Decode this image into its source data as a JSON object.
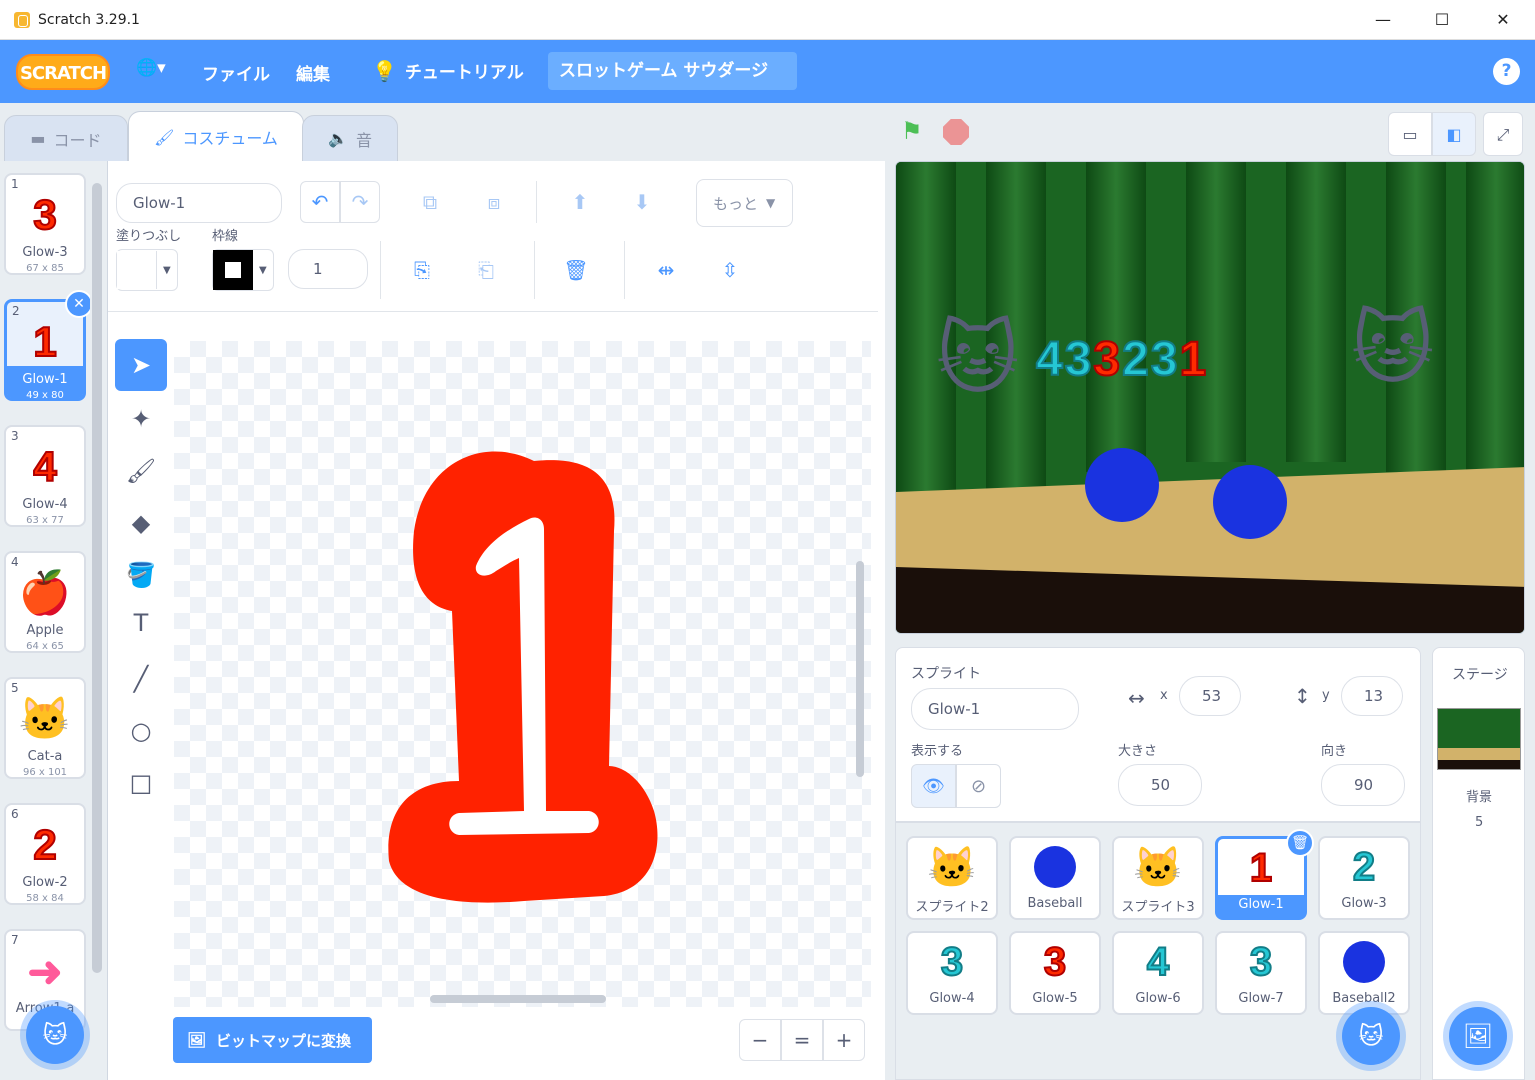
{
  "window": {
    "title": "Scratch 3.29.1",
    "minimize": "—",
    "maximize": "☐",
    "close": "✕"
  },
  "menubar": {
    "logo": "SCRATCH",
    "globe": "🌐▾",
    "file": "ファイル",
    "edit": "編集",
    "tutorials": "チュートリアル",
    "project_title": "スロットゲーム サウダージ",
    "help": "?"
  },
  "tabs": {
    "code": "コード",
    "costumes": "コスチューム",
    "sounds": "音"
  },
  "costumes": [
    {
      "num": "1",
      "glyph": "3",
      "name": "Glow-3",
      "size": "67 x 85",
      "color": "red"
    },
    {
      "num": "2",
      "glyph": "1",
      "name": "Glow-1",
      "size": "49 x 80",
      "color": "red",
      "selected": true
    },
    {
      "num": "3",
      "glyph": "4",
      "name": "Glow-4",
      "size": "63 x 77",
      "color": "red"
    },
    {
      "num": "4",
      "glyph": "🍎",
      "name": "Apple",
      "size": "64 x 65",
      "color": "emoji"
    },
    {
      "num": "5",
      "glyph": "🐱",
      "name": "Cat-a",
      "size": "96 x 101",
      "color": "emoji"
    },
    {
      "num": "6",
      "glyph": "2",
      "name": "Glow-2",
      "size": "58 x 84",
      "color": "red"
    },
    {
      "num": "7",
      "glyph": "➜",
      "name": "Arrow1-a",
      "size": "",
      "color": "pink"
    }
  ],
  "editor": {
    "costume_name": "Glow-1",
    "fill_label": "塗りつぶし",
    "outline_label": "枠線",
    "outline_width": "1",
    "more": "もっと",
    "convert_bitmap": "ビットマップに変換",
    "zoom_out": "−",
    "zoom_reset": "=",
    "zoom_in": "+",
    "canvas_glyph": "1"
  },
  "stage": {
    "numbers": [
      {
        "glyph": "4",
        "color": "teal"
      },
      {
        "glyph": "3",
        "color": "teal"
      },
      {
        "glyph": "3",
        "color": "red"
      },
      {
        "glyph": "2",
        "color": "teal"
      },
      {
        "glyph": "3",
        "color": "teal"
      },
      {
        "glyph": "1",
        "color": "red"
      }
    ]
  },
  "sprite_info": {
    "sprite_label": "スプライト",
    "sprite_name": "Glow-1",
    "x_label": "x",
    "x_value": "53",
    "y_label": "y",
    "y_value": "13",
    "show_label": "表示する",
    "size_label": "大きさ",
    "size_value": "50",
    "direction_label": "向き",
    "direction_value": "90"
  },
  "sprites": [
    {
      "name": "スプライト2",
      "glyph": "🐱",
      "kind": "emoji"
    },
    {
      "name": "Baseball",
      "glyph": "ball",
      "kind": "ball"
    },
    {
      "name": "スプライト3",
      "glyph": "🐱",
      "kind": "emoji"
    },
    {
      "name": "Glow-1",
      "glyph": "1",
      "kind": "red",
      "selected": true
    },
    {
      "name": "Glow-3",
      "glyph": "2",
      "kind": "teal"
    },
    {
      "name": "Glow-4",
      "glyph": "3",
      "kind": "teal"
    },
    {
      "name": "Glow-5",
      "glyph": "3",
      "kind": "red"
    },
    {
      "name": "Glow-6",
      "glyph": "4",
      "kind": "teal"
    },
    {
      "name": "Glow-7",
      "glyph": "3",
      "kind": "teal"
    },
    {
      "name": "Baseball2",
      "glyph": "ball",
      "kind": "ball"
    }
  ],
  "stage_panel": {
    "title": "ステージ",
    "backdrop_label": "背景",
    "backdrop_count": "5"
  },
  "colors": {
    "primary": "#4c97ff",
    "glow_red": "#ff2a00",
    "glow_teal": "#25c7d4",
    "stage_green": "#1a5a1f"
  }
}
